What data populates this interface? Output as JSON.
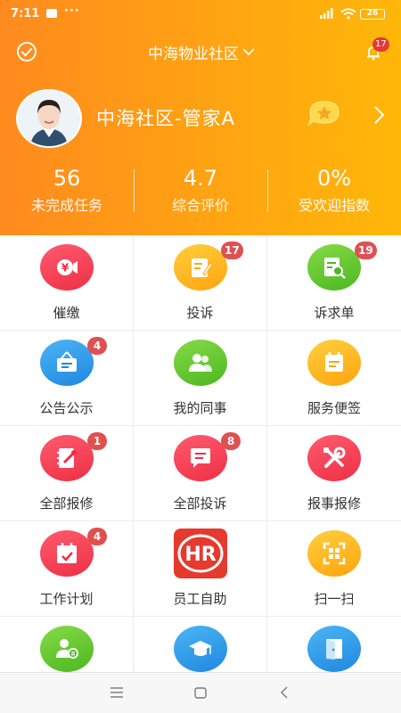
{
  "status_bar": {
    "time": "7:11",
    "dots": "···",
    "battery": "26"
  },
  "topbar": {
    "community_name": "中海物业社区",
    "notification_count": "17"
  },
  "profile": {
    "name": "中海社区-管家A"
  },
  "stats": [
    {
      "value": "56",
      "label": "未完成任务"
    },
    {
      "value": "4.7",
      "label": "综合评价"
    },
    {
      "value": "0%",
      "label": "受欢迎指数"
    }
  ],
  "grid": [
    {
      "label": "催缴",
      "icon": "yuan-megaphone-icon",
      "badge": ""
    },
    {
      "label": "投诉",
      "icon": "edit-note-icon",
      "badge": "17"
    },
    {
      "label": "诉求单",
      "icon": "document-search-icon",
      "badge": "19"
    },
    {
      "label": "公告公示",
      "icon": "notice-board-icon",
      "badge": "4"
    },
    {
      "label": "我的同事",
      "icon": "colleagues-icon",
      "badge": ""
    },
    {
      "label": "服务便签",
      "icon": "memo-icon",
      "badge": ""
    },
    {
      "label": "全部报修",
      "icon": "repair-notebook-icon",
      "badge": "1"
    },
    {
      "label": "全部投诉",
      "icon": "chat-bubble-icon",
      "badge": "8"
    },
    {
      "label": "报事报修",
      "icon": "tools-icon",
      "badge": ""
    },
    {
      "label": "工作计划",
      "icon": "calendar-check-icon",
      "badge": "4"
    },
    {
      "label": "员工自助",
      "icon": "hr-logo-icon",
      "badge": ""
    },
    {
      "label": "扫一扫",
      "icon": "scan-icon",
      "badge": ""
    },
    {
      "label": "",
      "icon": "user-card-icon",
      "badge": ""
    },
    {
      "label": "",
      "icon": "graduation-cap-icon",
      "badge": ""
    },
    {
      "label": "",
      "icon": "door-icon",
      "badge": ""
    }
  ],
  "colors": {
    "header_start": "#ff8a1e",
    "header_end": "#ffb708",
    "badge": "#e05050"
  }
}
